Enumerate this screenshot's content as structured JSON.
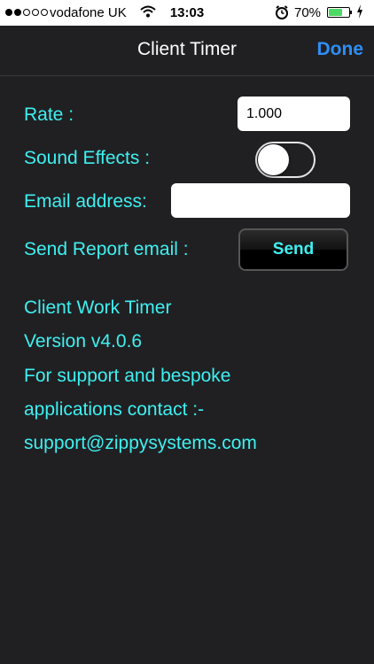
{
  "status_bar": {
    "carrier": "vodafone UK",
    "time": "13:03",
    "battery_percent": "70%",
    "battery_level": 0.7,
    "icons": [
      "signal-dots-icon",
      "wifi-icon",
      "alarm-icon",
      "battery-icon",
      "charging-bolt-icon"
    ]
  },
  "nav": {
    "title": "Client Timer",
    "done_label": "Done"
  },
  "settings": {
    "rate_label": "Rate :",
    "rate_value": "1.000",
    "sound_label": "Sound Effects :",
    "sound_enabled": false,
    "email_label": "Email address:",
    "email_value": "",
    "send_label": "Send Report email :",
    "send_button": "Send"
  },
  "info": {
    "line1": "Client Work Timer",
    "line2": "Version v4.0.6",
    "line3": "For support and bespoke",
    "line4": "applications contact :-",
    "line5": "support@zippysystems.com"
  },
  "colors": {
    "background": "#202023",
    "accent_text": "#3ff0f0",
    "done_blue": "#2f8ef5"
  }
}
